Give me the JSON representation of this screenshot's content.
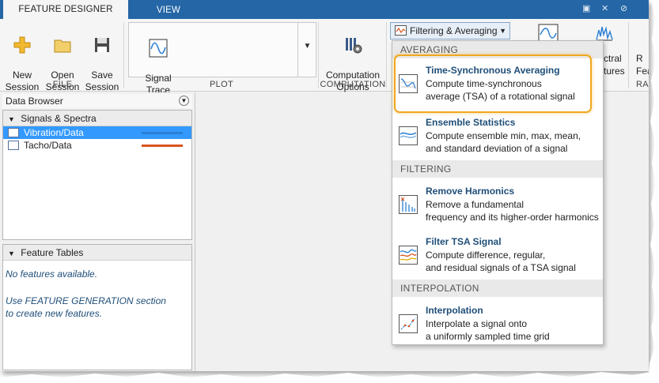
{
  "tabs": [
    {
      "label": "FEATURE DESIGNER",
      "active": true
    },
    {
      "label": "VIEW",
      "active": false
    }
  ],
  "window_controls": [
    "▣",
    "✕",
    "⊘"
  ],
  "toolstrip": {
    "file": {
      "label": "FILE",
      "new_session": "New\nSession",
      "open_session": "Open\nSession",
      "save_session": "Save\nSession"
    },
    "plot": {
      "label": "PLOT",
      "signal_trace": "Signal\nTrace"
    },
    "computation": {
      "label": "COMPUTATION",
      "computation_options": "Computation\nOptions"
    },
    "filtering_dropdown": "Filtering & Averaging",
    "partial_tools": {
      "spectral": "ctral",
      "tures": "tures",
      "feat_r": "R",
      "feat_f": "Feat",
      "ran": "RAN"
    }
  },
  "data_browser": {
    "title": "Data Browser",
    "signals_group": "Signals & Spectra",
    "signals": [
      {
        "name": "Vibration/Data",
        "selected": true,
        "color": "#2a7fd4"
      },
      {
        "name": "Tacho/Data",
        "selected": false,
        "color": "#d9541e"
      }
    ],
    "features_group": "Feature Tables",
    "no_features": "No features available.",
    "hint": "Use FEATURE GENERATION section\nto create new features."
  },
  "menu": {
    "sections": [
      {
        "label": "AVERAGING",
        "items": [
          {
            "title": "Time-Synchronous Averaging",
            "desc": "Compute time-synchronous\naverage (TSA) of a rotational signal",
            "icon": "tsa-icon",
            "highlighted": true
          },
          {
            "title": "Ensemble Statistics",
            "desc": "Compute ensemble min, max, mean,\nand standard deviation of a signal",
            "icon": "ensemble-icon"
          }
        ]
      },
      {
        "label": "FILTERING",
        "items": [
          {
            "title": "Remove Harmonics",
            "desc": "Remove a fundamental\nfrequency and its higher-order harmonics",
            "icon": "harmonics-icon"
          },
          {
            "title": "Filter TSA Signal",
            "desc": "Compute difference, regular,\nand residual signals of a TSA signal",
            "icon": "filter-tsa-icon"
          }
        ]
      },
      {
        "label": "INTERPOLATION",
        "items": [
          {
            "title": "Interpolation",
            "desc": "Interpolate a signal onto\na uniformly sampled time grid",
            "icon": "interpolation-icon"
          }
        ]
      }
    ]
  },
  "colors": {
    "tabbar": "#2466a6",
    "highlight": "#f0a820",
    "selection": "#3399ff",
    "title_blue": "#1f4e79"
  }
}
